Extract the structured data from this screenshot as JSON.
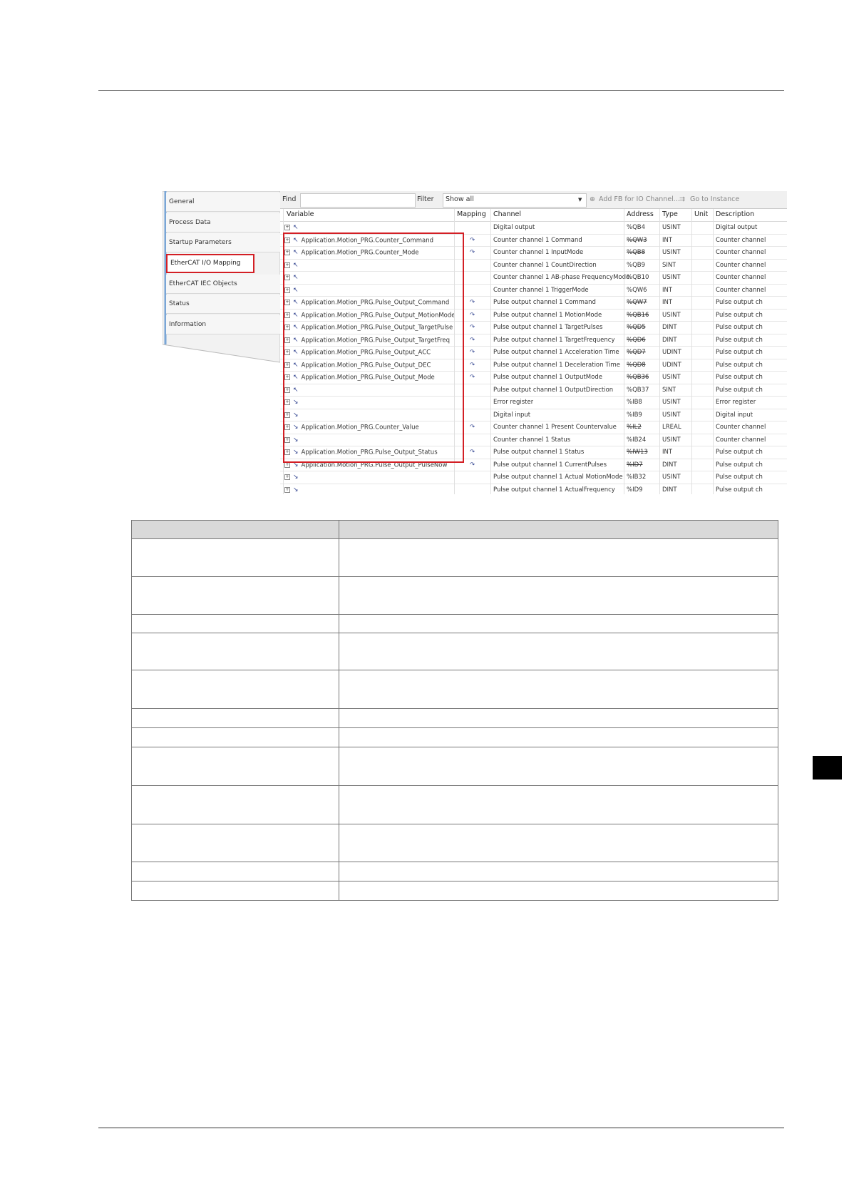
{
  "side_tabs": [
    "General",
    "Process Data",
    "Startup Parameters",
    "EtherCAT I/O Mapping",
    "EtherCAT IEC Objects",
    "Status",
    "Information"
  ],
  "toolbar": {
    "find_label": "Find",
    "filter_label": "Filter",
    "filter_value": "Show all",
    "add_fb_label": "Add FB for IO Channel...",
    "goto_label": "Go to Instance"
  },
  "columns": [
    "Variable",
    "Mapping",
    "Channel",
    "Address",
    "Type",
    "Unit",
    "Description"
  ],
  "rows": [
    {
      "variable": "",
      "mapped": false,
      "channel": "Digital output",
      "address": "%QB4",
      "strike": false,
      "type": "USINT",
      "description": "Digital output"
    },
    {
      "variable": "Application.Motion_PRG.Counter_Command",
      "mapped": true,
      "channel": "Counter channel 1 Command",
      "address": "%QW3",
      "strike": true,
      "type": "INT",
      "description": "Counter channel"
    },
    {
      "variable": "Application.Motion_PRG.Counter_Mode",
      "mapped": true,
      "channel": "Counter channel 1 InputMode",
      "address": "%QB8",
      "strike": true,
      "type": "USINT",
      "description": "Counter channel"
    },
    {
      "variable": "",
      "mapped": false,
      "channel": "Counter channel 1 CountDirection",
      "address": "%QB9",
      "strike": false,
      "type": "SINT",
      "description": "Counter channel"
    },
    {
      "variable": "",
      "mapped": false,
      "channel": "Counter channel 1 AB-phase FrequencyMode",
      "address": "%QB10",
      "strike": false,
      "type": "USINT",
      "description": "Counter channel"
    },
    {
      "variable": "",
      "mapped": false,
      "channel": "Counter channel 1 TriggerMode",
      "address": "%QW6",
      "strike": false,
      "type": "INT",
      "description": "Counter channel"
    },
    {
      "variable": "Application.Motion_PRG.Pulse_Output_Command",
      "mapped": true,
      "channel": "Pulse output channel 1 Command",
      "address": "%QW7",
      "strike": true,
      "type": "INT",
      "description": "Pulse output ch"
    },
    {
      "variable": "Application.Motion_PRG.Pulse_Output_MotionMode",
      "mapped": true,
      "channel": "Pulse output channel 1 MotionMode",
      "address": "%QB16",
      "strike": true,
      "type": "USINT",
      "description": "Pulse output ch"
    },
    {
      "variable": "Application.Motion_PRG.Pulse_Output_TargetPulse",
      "mapped": true,
      "channel": "Pulse output channel 1 TargetPulses",
      "address": "%QD5",
      "strike": true,
      "type": "DINT",
      "description": "Pulse output ch"
    },
    {
      "variable": "Application.Motion_PRG.Pulse_Output_TargetFreq",
      "mapped": true,
      "channel": "Pulse output channel 1 TargetFrequency",
      "address": "%QD6",
      "strike": true,
      "type": "DINT",
      "description": "Pulse output ch"
    },
    {
      "variable": "Application.Motion_PRG.Pulse_Output_ACC",
      "mapped": true,
      "channel": "Pulse output channel 1 Acceleration Time",
      "address": "%QD7",
      "strike": true,
      "type": "UDINT",
      "description": "Pulse output ch"
    },
    {
      "variable": "Application.Motion_PRG.Pulse_Output_DEC",
      "mapped": true,
      "channel": "Pulse output channel 1 Deceleration Time",
      "address": "%QD8",
      "strike": true,
      "type": "UDINT",
      "description": "Pulse output ch"
    },
    {
      "variable": "Application.Motion_PRG.Pulse_Output_Mode",
      "mapped": true,
      "channel": "Pulse output channel 1 OutputMode",
      "address": "%QB36",
      "strike": true,
      "type": "USINT",
      "description": "Pulse output ch"
    },
    {
      "variable": "",
      "mapped": false,
      "channel": "Pulse output channel 1 OutputDirection",
      "address": "%QB37",
      "strike": false,
      "type": "SINT",
      "description": "Pulse output ch"
    },
    {
      "variable": "",
      "mapped": false,
      "channel": "Error register",
      "address": "%IB8",
      "strike": false,
      "type": "USINT",
      "description": "Error register"
    },
    {
      "variable": "",
      "mapped": false,
      "channel": "Digital input",
      "address": "%IB9",
      "strike": false,
      "type": "USINT",
      "description": "Digital input"
    },
    {
      "variable": "Application.Motion_PRG.Counter_Value",
      "mapped": true,
      "channel": "Counter channel 1 Present Countervalue",
      "address": "%IL2",
      "strike": true,
      "type": "LREAL",
      "description": "Counter channel"
    },
    {
      "variable": "",
      "mapped": false,
      "channel": "Counter channel 1 Status",
      "address": "%IB24",
      "strike": false,
      "type": "USINT",
      "description": "Counter channel"
    },
    {
      "variable": "Application.Motion_PRG.Pulse_Output_Status",
      "mapped": true,
      "channel": "Pulse output channel 1 Status",
      "address": "%IW13",
      "strike": true,
      "type": "INT",
      "description": "Pulse output ch"
    },
    {
      "variable": "Application.Motion_PRG.Pulse_Output_PulseNow",
      "mapped": true,
      "channel": "Pulse output channel 1 CurrentPulses",
      "address": "%ID7",
      "strike": true,
      "type": "DINT",
      "description": "Pulse output ch"
    },
    {
      "variable": "",
      "mapped": false,
      "channel": "Pulse output channel 1 Actual MotionMode",
      "address": "%IB32",
      "strike": false,
      "type": "USINT",
      "description": "Pulse output ch"
    },
    {
      "variable": "",
      "mapped": false,
      "channel": "Pulse output channel 1 ActualFrequency",
      "address": "%ID9",
      "strike": false,
      "type": "DINT",
      "description": "Pulse output ch"
    }
  ],
  "colors": {
    "highlight": "#d31f25",
    "mapping_icon": "#2b3e8c",
    "table_header": "#d9d9d9"
  },
  "icons": {
    "expand": "plus-box-icon",
    "output": "output-arrow-icon",
    "input": "input-arrow-icon",
    "mapping": "mapping-icon"
  }
}
